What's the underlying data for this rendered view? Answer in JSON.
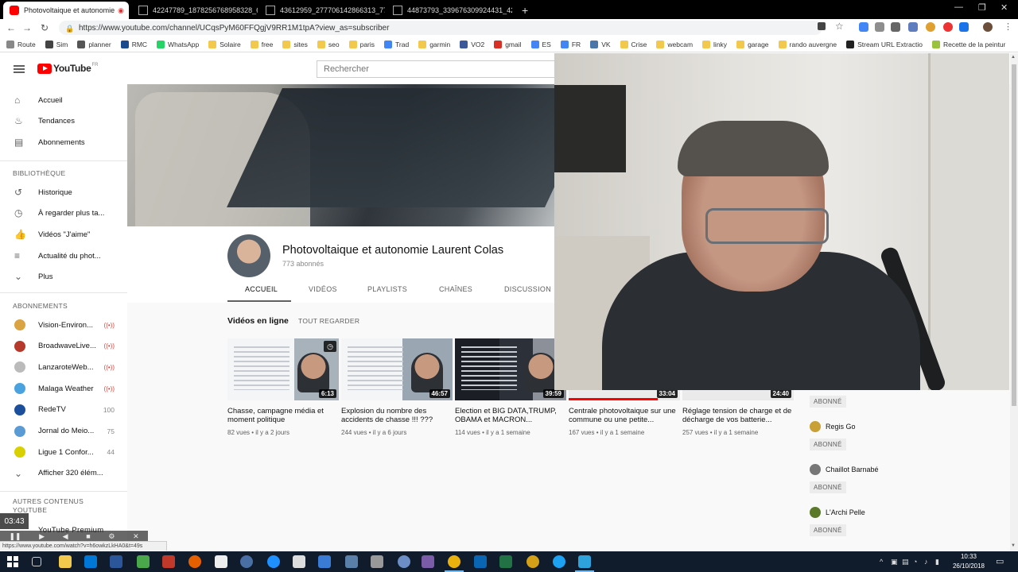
{
  "browser": {
    "tabs": [
      {
        "label": "Photovoltaique et autonomie",
        "active": true
      },
      {
        "label": "42247789_1878256768958328_6",
        "active": false
      },
      {
        "label": "43612959_277706142866313_77",
        "active": false
      },
      {
        "label": "44873793_339676309924431_42",
        "active": false
      }
    ],
    "new_tab": "+",
    "url": "https://www.youtube.com/channel/UCqsPyM60FFQgjV9RR1M1tpA?view_as=subscriber",
    "bookmarks": [
      {
        "label": "Route",
        "color": "#888888"
      },
      {
        "label": "Sim",
        "color": "#444444"
      },
      {
        "label": "planner",
        "color": "#555555"
      },
      {
        "label": "RMC",
        "color": "#1a4b8c"
      },
      {
        "label": "WhatsApp",
        "color": "#25d366"
      },
      {
        "label": "Solaire",
        "color": "#f2c94c"
      },
      {
        "label": "free",
        "color": "#f2c94c"
      },
      {
        "label": "sites",
        "color": "#f2c94c"
      },
      {
        "label": "seo",
        "color": "#f2c94c"
      },
      {
        "label": "paris",
        "color": "#f2c94c"
      },
      {
        "label": "Trad",
        "color": "#4285f4"
      },
      {
        "label": "garmin",
        "color": "#f2c94c"
      },
      {
        "label": "VO2",
        "color": "#3b5998"
      },
      {
        "label": "gmail",
        "color": "#d93025"
      },
      {
        "label": "ES",
        "color": "#4285f4"
      },
      {
        "label": "FR",
        "color": "#4285f4"
      },
      {
        "label": "VK",
        "color": "#4a76a8"
      },
      {
        "label": "Crise",
        "color": "#f2c94c"
      },
      {
        "label": "webcam",
        "color": "#f2c94c"
      },
      {
        "label": "linky",
        "color": "#f2c94c"
      },
      {
        "label": "garage",
        "color": "#f2c94c"
      },
      {
        "label": "rando auvergne",
        "color": "#f2c94c"
      },
      {
        "label": "Stream URL Extractio",
        "color": "#222222"
      },
      {
        "label": "Recette de la peintur",
        "color": "#9ac23c"
      }
    ]
  },
  "youtube": {
    "logo": "YouTube",
    "logo_country": "FR",
    "search_placeholder": "Rechercher",
    "sidebar": {
      "main": [
        {
          "label": "Accueil",
          "icon": "home-icon"
        },
        {
          "label": "Tendances",
          "icon": "flame-icon"
        },
        {
          "label": "Abonnements",
          "icon": "subscriptions-icon"
        }
      ],
      "library_heading": "BIBLIOTHÈQUE",
      "library": [
        {
          "label": "Historique",
          "icon": "history-icon"
        },
        {
          "label": "À regarder plus ta...",
          "icon": "watch-later-icon"
        },
        {
          "label": "Vidéos \"J'aime\"",
          "icon": "thumbs-up-icon"
        },
        {
          "label": "Actualité du phot...",
          "icon": "playlist-icon"
        },
        {
          "label": "Plus",
          "icon": "chevron-down-icon"
        }
      ],
      "subs_heading": "ABONNEMENTS",
      "subscriptions": [
        {
          "label": "Vision-Environ...",
          "badge": "((•))",
          "count": "",
          "color": "#d9a441"
        },
        {
          "label": "BroadwaveLive...",
          "badge": "((•))",
          "count": "",
          "color": "#b63a2b"
        },
        {
          "label": "LanzaroteWeb...",
          "badge": "((•))",
          "count": "",
          "color": "#bbbbbb"
        },
        {
          "label": "Malaga Weather",
          "badge": "((•))",
          "count": "",
          "color": "#4aa3df"
        },
        {
          "label": "RedeTV",
          "badge": "",
          "count": "100",
          "color": "#1b4f9c"
        },
        {
          "label": "Jornal do Meio...",
          "badge": "",
          "count": "75",
          "color": "#5a9bd5"
        },
        {
          "label": "Ligue 1 Confor...",
          "badge": "",
          "count": "44",
          "color": "#d8d000"
        },
        {
          "label": "Afficher 320 élém...",
          "badge": "",
          "count": "",
          "color": ""
        }
      ],
      "other_heading": "AUTRES CONTENUS YOUTUBE",
      "other_item": "YouTube Premium"
    },
    "channel": {
      "name": "Photovoltaique et autonomie Laurent Colas",
      "subscribers": "773 abonnés",
      "tabs": [
        "ACCUEIL",
        "VIDÉOS",
        "PLAYLISTS",
        "CHAÎNES",
        "DISCUSSION"
      ],
      "active_tab": "ACCUEIL"
    },
    "section": {
      "title": "Vidéos en ligne",
      "play_all": "TOUT REGARDER"
    },
    "videos": [
      {
        "title": "Chasse, campagne média et moment politique",
        "views": "82 vues",
        "age": "il y a 2 jours",
        "duration": "6:13",
        "progress": 0
      },
      {
        "title": "Explosion du nombre des accidents de chasse !!! ???",
        "views": "244 vues",
        "age": "il y a 6 jours",
        "duration": "46:57",
        "progress": 0
      },
      {
        "title": "Election et BIG DATA,TRUMP, OBAMA et MACRON...",
        "views": "114 vues",
        "age": "il y a 1 semaine",
        "duration": "39:59",
        "progress": 0
      },
      {
        "title": "Centrale photovoltaique sur une commune ou une petite...",
        "views": "167 vues",
        "age": "il y a 1 semaine",
        "duration": "33:04",
        "progress": 80
      },
      {
        "title": "Réglage tension de charge et de décharge de vos batterie...",
        "views": "257 vues",
        "age": "il y a 1 semaine",
        "duration": "24:40",
        "progress": 0
      }
    ],
    "subscribers_list": {
      "button": "ABONNÉ",
      "people": [
        {
          "name": "",
          "color": ""
        },
        {
          "name": "Regis Go",
          "color": "#c8a035"
        },
        {
          "name": "Chaillot Barnabé",
          "color": "#777777"
        },
        {
          "name": "L'Archi Pelle",
          "color": "#5a7a2a"
        }
      ]
    }
  },
  "overlay": {
    "time": "03:43",
    "status_url": "https://www.youtube.com/watch?v=h6owkzLkHA0&t=49s"
  },
  "taskbar": {
    "time": "10:33",
    "date": "26/10/2018"
  }
}
